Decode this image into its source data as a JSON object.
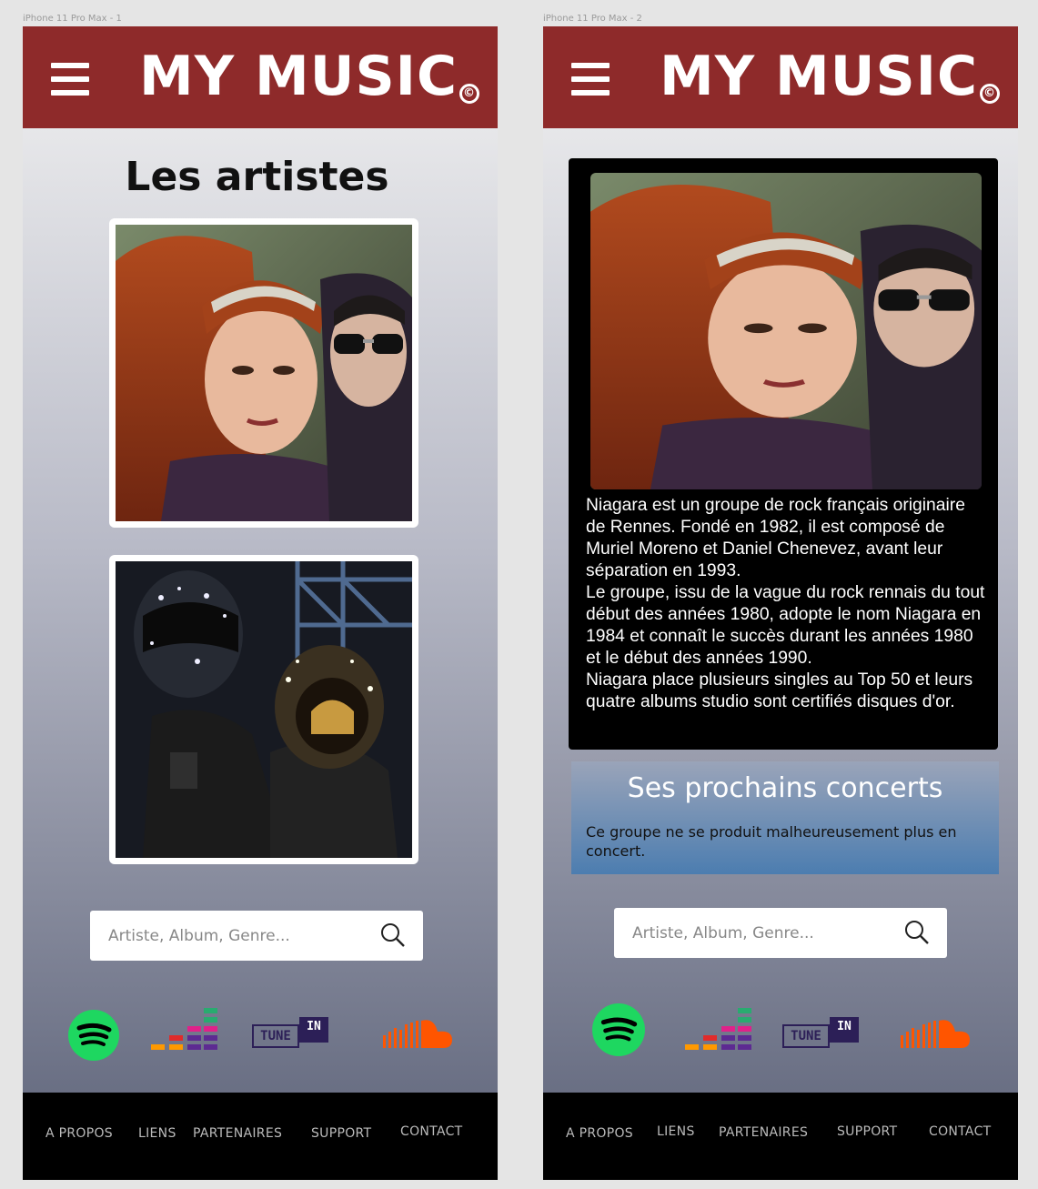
{
  "screens": [
    {
      "frame_label": "iPhone 11 Pro Max - 1",
      "header": {
        "brand": "MY MUSIC",
        "brand_mark": "©"
      },
      "title": "Les artistes",
      "artists": [
        {
          "image_desc": "Niagara duo photo"
        },
        {
          "image_desc": "Daft Punk helmets photo"
        }
      ],
      "search": {
        "placeholder": "Artiste, Album, Genre..."
      },
      "services": [
        "spotify-icon",
        "deezer-icon",
        "tunein-icon",
        "soundcloud-icon"
      ],
      "tunein": {
        "left": "TUNE",
        "right": "IN"
      },
      "footer": [
        "A PROPOS",
        "LIENS",
        "PARTENAIRES",
        "SUPPORT",
        "CONTACT"
      ]
    },
    {
      "frame_label": "iPhone 11 Pro Max - 2",
      "header": {
        "brand": "MY MUSIC",
        "brand_mark": "©"
      },
      "bio": [
        "Niagara est un groupe de rock français originaire de Rennes. Fondé en 1982, il est composé de Muriel Moreno et Daniel Chenevez, avant leur séparation en 1993.",
        "Le groupe, issu de la vague du rock rennais du tout début des années 1980, adopte le nom Niagara en 1984 et connaît le succès durant les années 1980 et le début des années 1990.",
        "Niagara place plusieurs singles au Top 50 et leurs quatre albums studio sont certifiés disques d'or."
      ],
      "concerts": {
        "title": "Ses prochains concerts",
        "text": "Ce groupe ne se produit malheureusement plus en concert."
      },
      "search": {
        "placeholder": "Artiste, Album, Genre..."
      },
      "services": [
        "spotify-icon",
        "deezer-icon",
        "tunein-icon",
        "soundcloud-icon"
      ],
      "tunein": {
        "left": "TUNE",
        "right": "IN"
      },
      "footer": [
        "A PROPOS",
        "LIENS",
        "PARTENAIRES",
        "SUPPORT",
        "CONTACT"
      ]
    }
  ],
  "colors": {
    "header": "#8e2a2a",
    "footer": "#000000",
    "spotify": "#1ed760",
    "soundcloud": "#ff5500",
    "tunein": "#2c1f57"
  }
}
